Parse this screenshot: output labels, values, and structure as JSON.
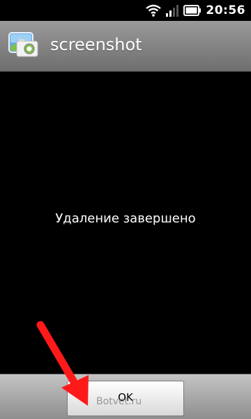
{
  "status_bar": {
    "time": "20:56",
    "icons": [
      "wifi-icon",
      "signal-icon",
      "battery-icon"
    ]
  },
  "app": {
    "title": "screenshot",
    "icon": "screenshot-app-icon"
  },
  "content": {
    "message": "Удаление завершено"
  },
  "footer": {
    "ok_label": "OK"
  },
  "overlay": {
    "watermark": "Botvet.ru",
    "arrow_color": "#ff1a1a"
  },
  "colors": {
    "titlebar": "#8a8a8a",
    "background": "#000000"
  }
}
